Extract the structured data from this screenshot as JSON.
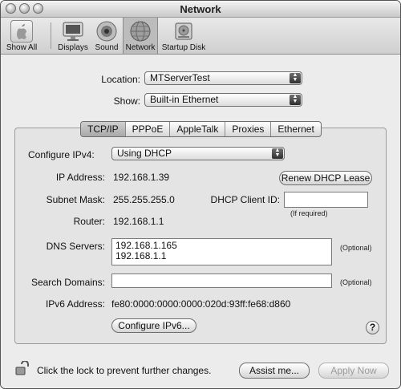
{
  "window": {
    "title": "Network"
  },
  "toolbar": {
    "items": [
      {
        "label": "Show All"
      },
      {
        "label": "Displays"
      },
      {
        "label": "Sound"
      },
      {
        "label": "Network"
      },
      {
        "label": "Startup Disk"
      }
    ]
  },
  "location": {
    "label": "Location:",
    "value": "MTServerTest"
  },
  "show": {
    "label": "Show:",
    "value": "Built-in Ethernet"
  },
  "tabs": [
    "TCP/IP",
    "PPPoE",
    "AppleTalk",
    "Proxies",
    "Ethernet"
  ],
  "tcpip": {
    "configure_label": "Configure IPv4:",
    "configure_value": "Using DHCP",
    "ip_label": "IP Address:",
    "ip_value": "192.168.1.39",
    "renew_button": "Renew DHCP Lease",
    "subnet_label": "Subnet Mask:",
    "subnet_value": "255.255.255.0",
    "client_id_label": "DHCP Client ID:",
    "client_id_value": "",
    "if_required": "(If required)",
    "router_label": "Router:",
    "router_value": "192.168.1.1",
    "dns_label": "DNS Servers:",
    "dns_values": [
      "192.168.1.165",
      "192.168.1.1"
    ],
    "dns_optional": "(Optional)",
    "search_label": "Search Domains:",
    "search_value": "",
    "search_optional": "(Optional)",
    "ipv6_label": "IPv6 Address:",
    "ipv6_value": "fe80:0000:0000:0000:020d:93ff:fe68:d860",
    "configure_ipv6_button": "Configure IPv6...",
    "help": "?"
  },
  "footer": {
    "lock_text": "Click the lock to prevent further changes.",
    "assist_button": "Assist me...",
    "apply_button": "Apply Now"
  }
}
